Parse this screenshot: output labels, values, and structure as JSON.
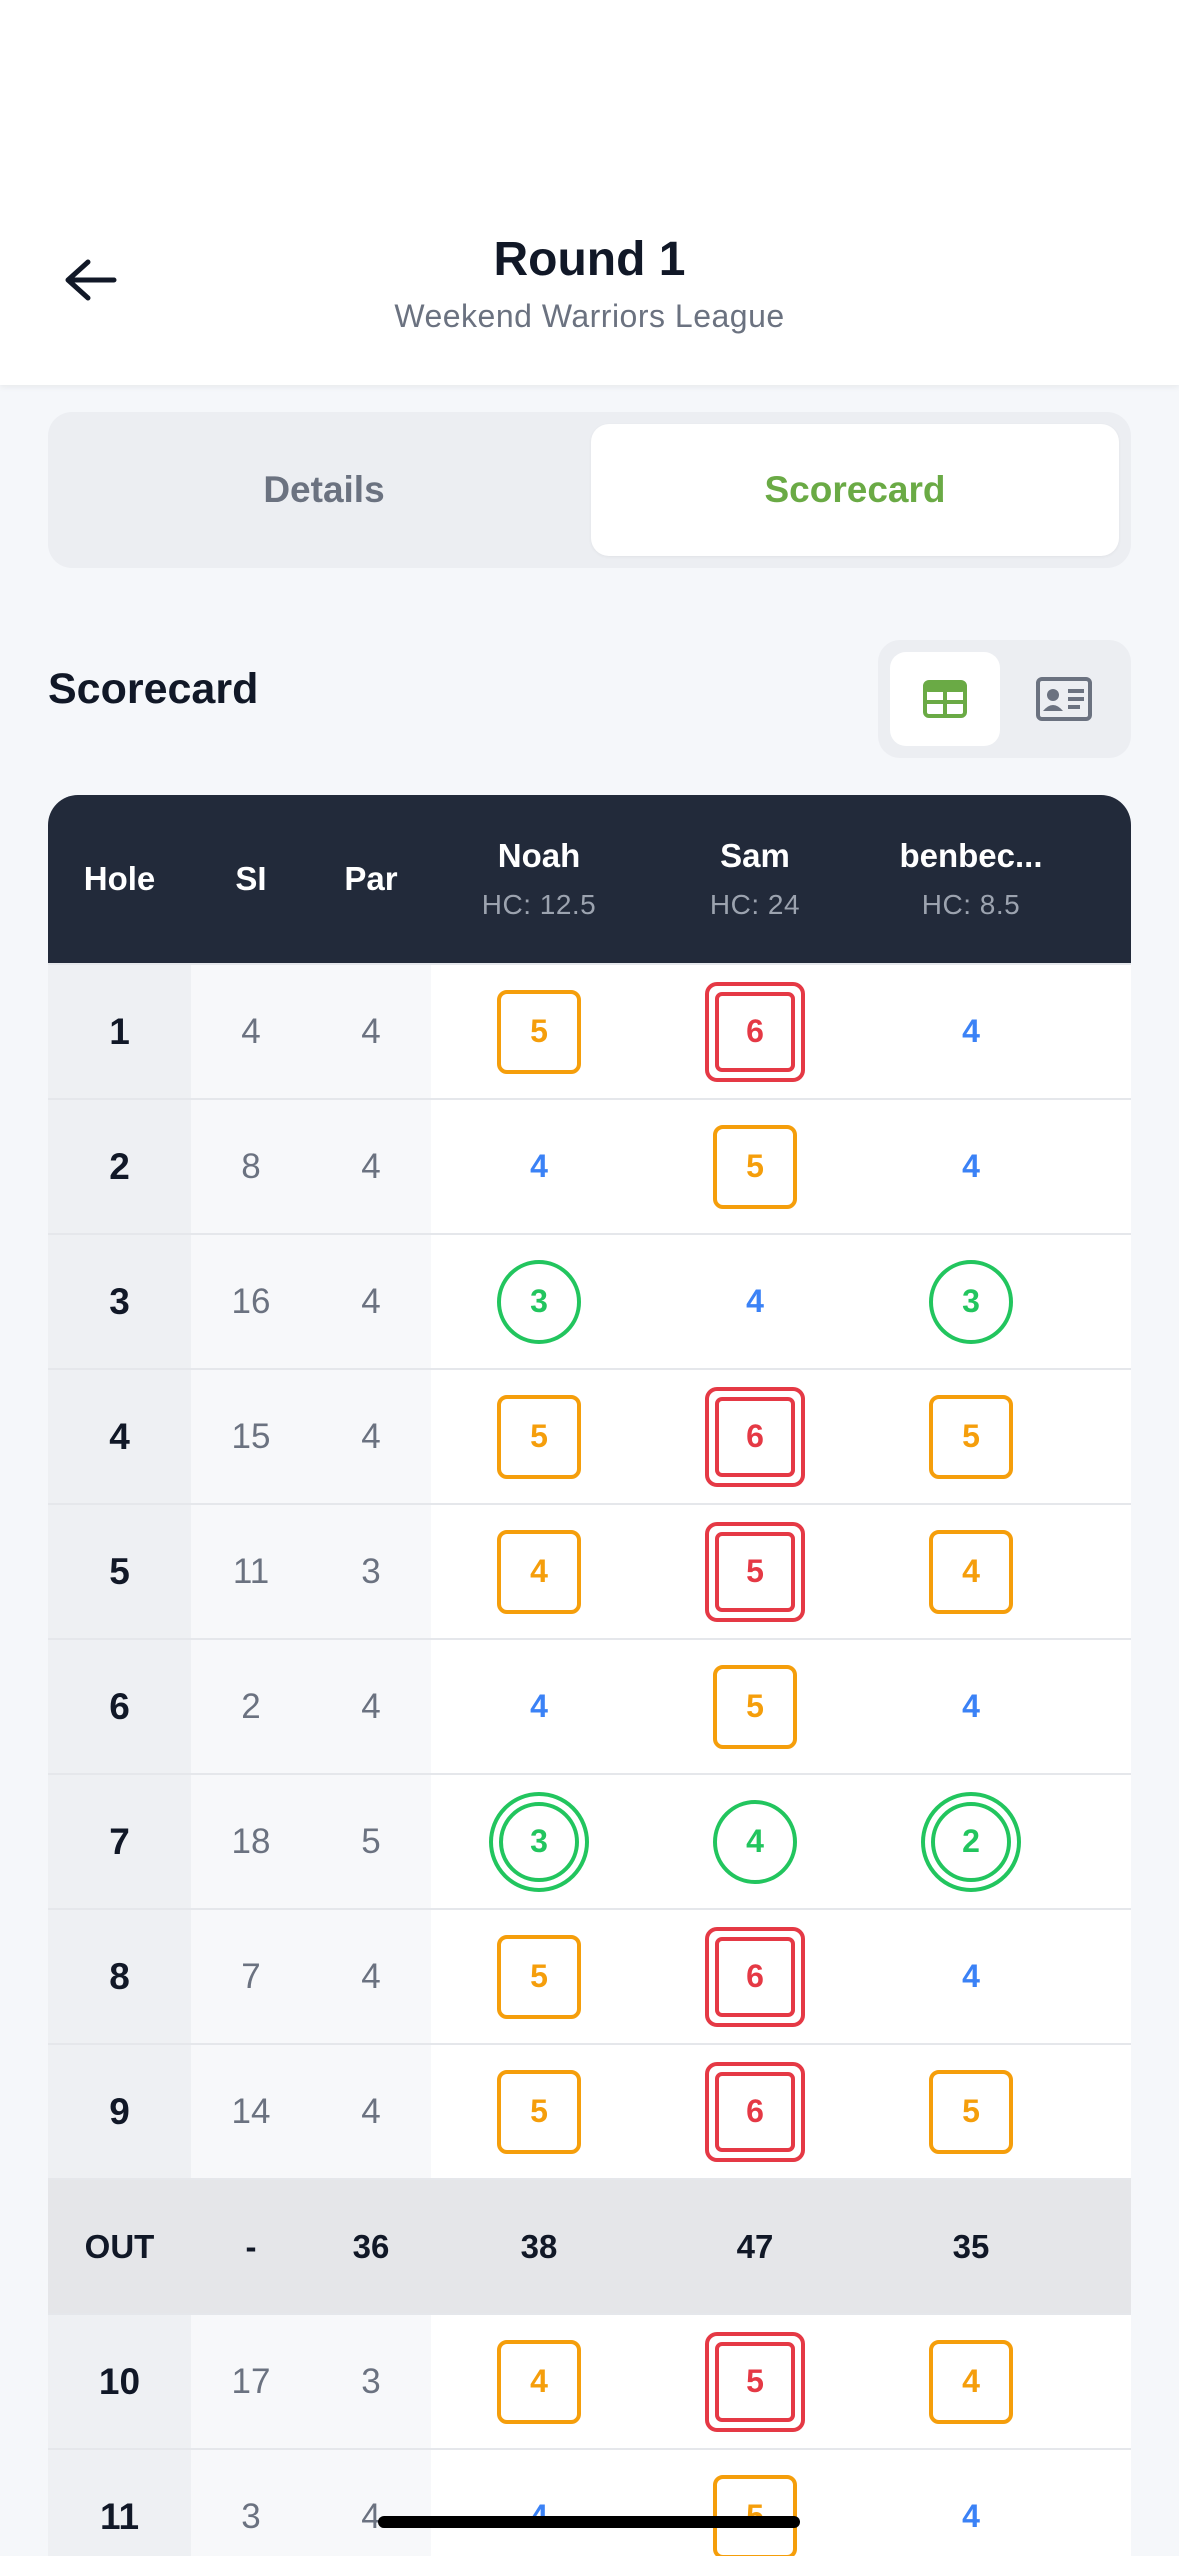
{
  "header": {
    "title": "Round 1",
    "subtitle": "Weekend Warriors League",
    "back_icon": "arrow-left-icon"
  },
  "tabs": [
    {
      "label": "Details",
      "active": false
    },
    {
      "label": "Scorecard",
      "active": true
    }
  ],
  "section": {
    "title": "Scorecard",
    "view_modes": [
      {
        "icon": "table-grid-icon",
        "active": true
      },
      {
        "icon": "id-card-icon",
        "active": false
      }
    ]
  },
  "colors": {
    "accent": "#6aaa45",
    "header_bg": "#222a3a",
    "par": "#3b82f6",
    "bogey": "#f59e0b",
    "double_bogey": "#e53945",
    "birdie": "#22c55e"
  },
  "table": {
    "columns": {
      "hole": "Hole",
      "si": "SI",
      "par": "Par"
    },
    "players": [
      {
        "name": "Noah",
        "hc": "HC: 12.5"
      },
      {
        "name": "Sam",
        "hc": "HC: 24"
      },
      {
        "name": "benbec...",
        "hc": "HC: 8.5"
      }
    ],
    "rows": [
      {
        "hole": "1",
        "si": "4",
        "par": "4",
        "scores": [
          {
            "v": "5",
            "t": "bogey"
          },
          {
            "v": "6",
            "t": "dbl"
          },
          {
            "v": "4",
            "t": "plain"
          }
        ]
      },
      {
        "hole": "2",
        "si": "8",
        "par": "4",
        "scores": [
          {
            "v": "4",
            "t": "plain"
          },
          {
            "v": "5",
            "t": "bogey"
          },
          {
            "v": "4",
            "t": "plain"
          }
        ]
      },
      {
        "hole": "3",
        "si": "16",
        "par": "4",
        "scores": [
          {
            "v": "3",
            "t": "birdie"
          },
          {
            "v": "4",
            "t": "plain"
          },
          {
            "v": "3",
            "t": "birdie"
          }
        ]
      },
      {
        "hole": "4",
        "si": "15",
        "par": "4",
        "scores": [
          {
            "v": "5",
            "t": "bogey"
          },
          {
            "v": "6",
            "t": "dbl"
          },
          {
            "v": "5",
            "t": "bogey"
          }
        ]
      },
      {
        "hole": "5",
        "si": "11",
        "par": "3",
        "scores": [
          {
            "v": "4",
            "t": "bogey"
          },
          {
            "v": "5",
            "t": "dbl"
          },
          {
            "v": "4",
            "t": "bogey"
          }
        ]
      },
      {
        "hole": "6",
        "si": "2",
        "par": "4",
        "scores": [
          {
            "v": "4",
            "t": "plain"
          },
          {
            "v": "5",
            "t": "bogey"
          },
          {
            "v": "4",
            "t": "plain"
          }
        ]
      },
      {
        "hole": "7",
        "si": "18",
        "par": "5",
        "scores": [
          {
            "v": "3",
            "t": "eagle"
          },
          {
            "v": "4",
            "t": "birdie"
          },
          {
            "v": "2",
            "t": "eagle"
          }
        ]
      },
      {
        "hole": "8",
        "si": "7",
        "par": "4",
        "scores": [
          {
            "v": "5",
            "t": "bogey"
          },
          {
            "v": "6",
            "t": "dbl"
          },
          {
            "v": "4",
            "t": "plain"
          }
        ]
      },
      {
        "hole": "9",
        "si": "14",
        "par": "4",
        "scores": [
          {
            "v": "5",
            "t": "bogey"
          },
          {
            "v": "6",
            "t": "dbl"
          },
          {
            "v": "5",
            "t": "bogey"
          }
        ]
      }
    ],
    "out": {
      "label": "OUT",
      "si": "-",
      "par": "36",
      "totals": [
        "38",
        "47",
        "35"
      ]
    },
    "rows_back": [
      {
        "hole": "10",
        "si": "17",
        "par": "3",
        "scores": [
          {
            "v": "4",
            "t": "bogey"
          },
          {
            "v": "5",
            "t": "dbl"
          },
          {
            "v": "4",
            "t": "bogey"
          }
        ]
      },
      {
        "hole": "11",
        "si": "3",
        "par": "4",
        "scores": [
          {
            "v": "4",
            "t": "plain"
          },
          {
            "v": "5",
            "t": "bogey"
          },
          {
            "v": "4",
            "t": "plain"
          }
        ]
      }
    ]
  }
}
